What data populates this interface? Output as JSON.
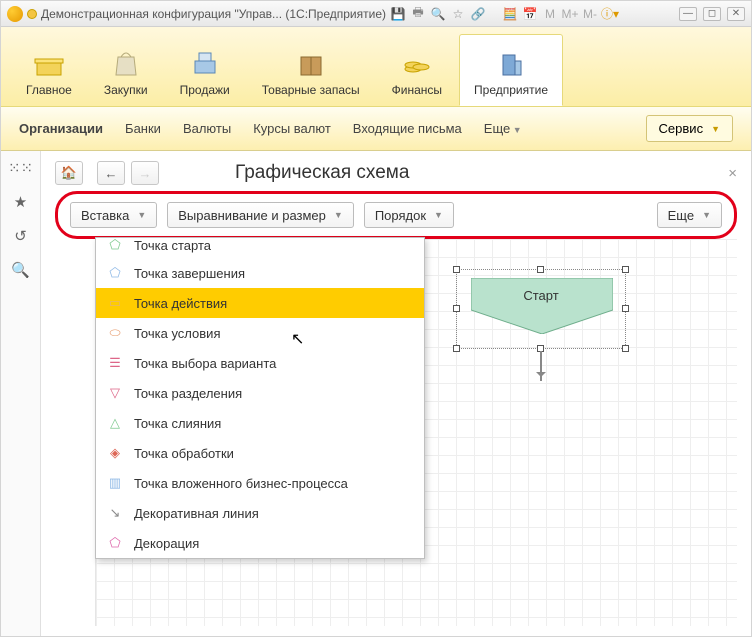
{
  "title": "Демонстрационная конфигурация \"Управ...  (1С:Предприятие)",
  "tiles": [
    {
      "label": "Главное",
      "icon": "🟨"
    },
    {
      "label": "Закупки",
      "icon": "🛍️"
    },
    {
      "label": "Продажи",
      "icon": "💰"
    },
    {
      "label": "Товарные запасы",
      "icon": "📦"
    },
    {
      "label": "Финансы",
      "icon": "🪙"
    },
    {
      "label": "Предприятие",
      "icon": "🏢"
    }
  ],
  "secondary": {
    "org": "Организации",
    "banks": "Банки",
    "currencies": "Валюты",
    "rates": "Курсы валют",
    "inbox": "Входящие письма",
    "more": "Еще",
    "service": "Сервис"
  },
  "page": {
    "title": "Графическая схема"
  },
  "actions": {
    "insert": "Вставка",
    "align": "Выравнивание и размер",
    "order": "Порядок",
    "more": "Еще"
  },
  "node": {
    "start": "Старт"
  },
  "dropdown": [
    {
      "label": "Точка старта",
      "ico": "⬠",
      "color": "#7fc98f"
    },
    {
      "label": "Точка завершения",
      "ico": "⬠",
      "color": "#8fb9e6"
    },
    {
      "label": "Точка действия",
      "ico": "▭",
      "color": "#e6b76a",
      "hl": true
    },
    {
      "label": "Точка условия",
      "ico": "⬭",
      "color": "#e6996a"
    },
    {
      "label": "Точка выбора варианта",
      "ico": "☰",
      "color": "#d68"
    },
    {
      "label": "Точка разделения",
      "ico": "▽",
      "color": "#d68"
    },
    {
      "label": "Точка слияния",
      "ico": "△",
      "color": "#7fc98f"
    },
    {
      "label": "Точка обработки",
      "ico": "◈",
      "color": "#d65"
    },
    {
      "label": "Точка вложенного бизнес-процесса",
      "ico": "▥",
      "color": "#8fb9e6"
    },
    {
      "label": "Декоративная линия",
      "ico": "↘",
      "color": "#888"
    },
    {
      "label": "Декорация",
      "ico": "⬠",
      "color": "#d6a"
    }
  ]
}
